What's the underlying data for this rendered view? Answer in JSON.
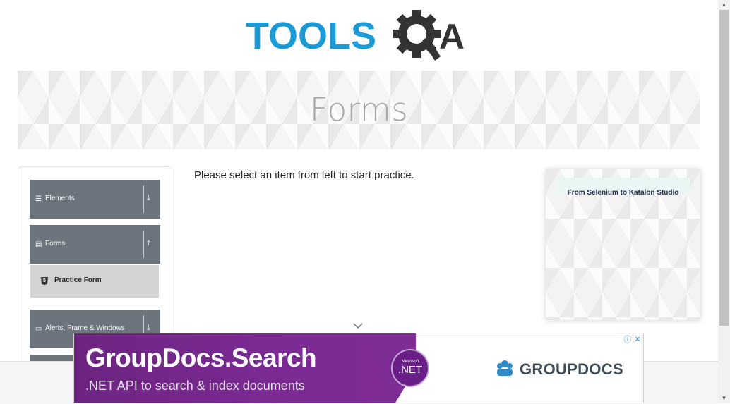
{
  "logo": {
    "text_tools": "TOOLS",
    "text_qa": "QA"
  },
  "banner": {
    "title": "Forms"
  },
  "sidebar": {
    "groups": [
      {
        "label": "Elements",
        "icon": "hamburger-icon",
        "arrow": "download-icon"
      },
      {
        "label": "Forms",
        "icon": "document-icon",
        "arrow": "upload-icon"
      },
      {
        "label": "Alerts, Frame & Windows",
        "icon": "window-icon",
        "arrow": "download-icon"
      }
    ],
    "active_item": {
      "label": "Practice Form",
      "icon": "html5-icon",
      "icon_text": "5"
    }
  },
  "main": {
    "message": "Please select an item from left to start practice."
  },
  "side_ad": {
    "heading": "From Selenium to Katalon Studio"
  },
  "bottom_ad": {
    "title": "GroupDocs.Search",
    "subtitle": ".NET API to search & index documents",
    "badge_small": "Microsoft",
    "badge_big": ".NET",
    "brand": "GROUPDOCS",
    "info_glyph": "ⓘ",
    "close_glyph": "✕"
  },
  "colors": {
    "tools_blue": "#1a9bd7",
    "qa_dark": "#333333",
    "group_bg": "#6c757d",
    "active_bg": "#d3d3d3",
    "ad_purple": "#7b2a94"
  }
}
